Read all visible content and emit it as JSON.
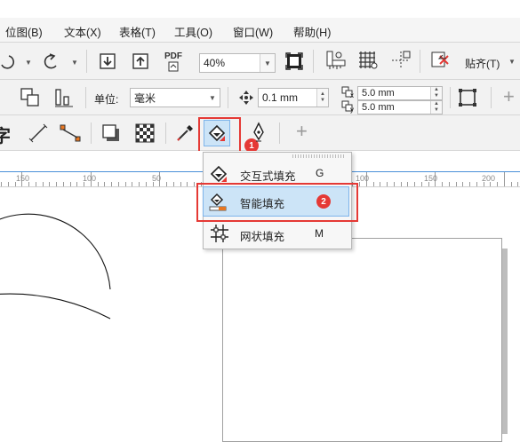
{
  "menubar": {
    "items": [
      "位图(B)",
      "文本(X)",
      "表格(T)",
      "工具(O)",
      "窗口(W)",
      "帮助(H)"
    ]
  },
  "toolbar": {
    "zoom_value": "40%",
    "snap_label": "贴齐(T)",
    "pdf_label": "PDF"
  },
  "propertybar": {
    "unit_label": "单位:",
    "unit_value": "毫米",
    "nudge_value": "0.1 mm",
    "dup_x": "5.0 mm",
    "dup_y": "5.0 mm",
    "x_sub": "x",
    "y_sub": "y"
  },
  "toolbox": {
    "partial_glyph": "字",
    "plus": "+"
  },
  "ruler": {
    "labels": [
      "150",
      "100",
      "50",
      "50",
      "100",
      "150",
      "200"
    ]
  },
  "flyout": {
    "items": [
      {
        "label": "交互式填充",
        "shortcut": "G"
      },
      {
        "label": "智能填充",
        "shortcut": ""
      },
      {
        "label": "网状填充",
        "shortcut": "M"
      }
    ]
  },
  "annotations": {
    "badge1": "1",
    "badge2": "2",
    "accent": "#e53935"
  },
  "colors": {
    "highlight": "#cce4f7",
    "highlight_border": "#7eb4ea",
    "red_callout": "#e53935"
  }
}
